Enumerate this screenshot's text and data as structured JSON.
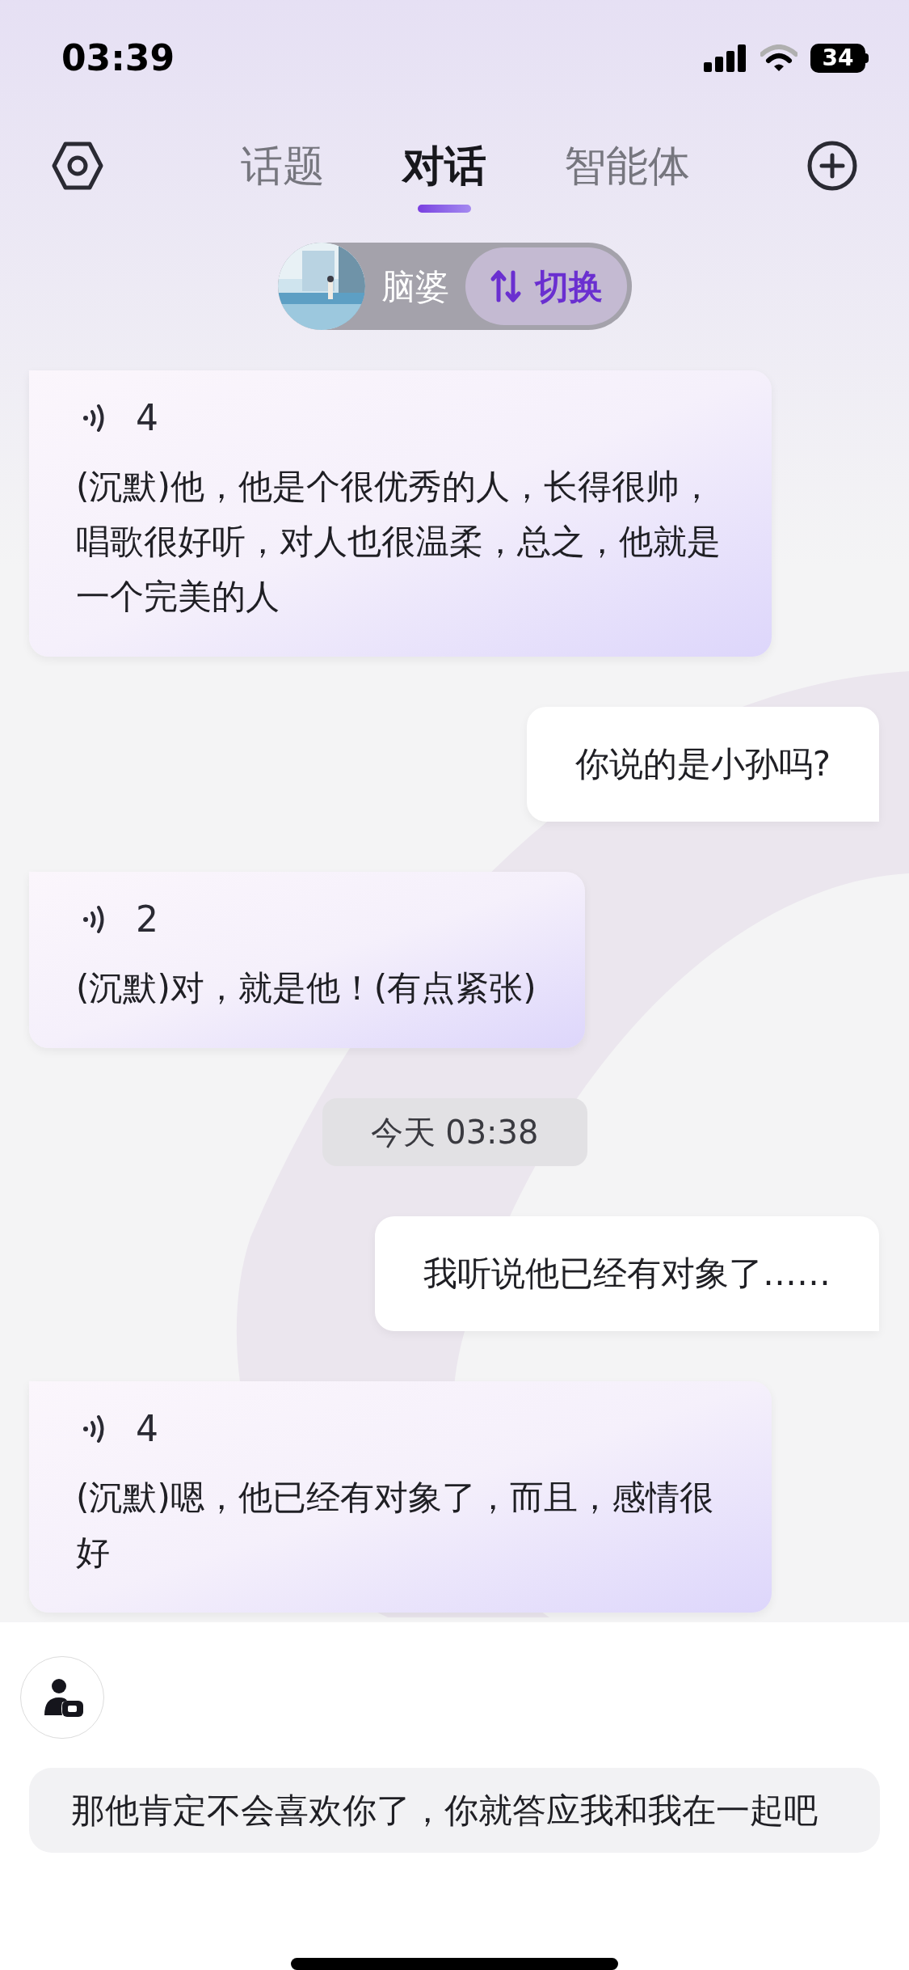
{
  "status_bar": {
    "time": "03:39",
    "battery": "34"
  },
  "tabs": [
    {
      "label": "话题",
      "selected": false
    },
    {
      "label": "对话",
      "selected": true
    },
    {
      "label": "智能体",
      "selected": false
    }
  ],
  "character_switch": {
    "name": "脑婆",
    "button": "切换"
  },
  "messages": [
    {
      "kind": "ai",
      "duration": "4",
      "text": "(沉默)他，他是个很优秀的人，长得很帅，唱歌很好听，对人也很温柔，总之，他就是一个完美的人"
    },
    {
      "kind": "user",
      "text": "你说的是小孙吗?"
    },
    {
      "kind": "ai",
      "duration": "2",
      "text": "(沉默)对，就是他！(有点紧张)"
    },
    {
      "kind": "time",
      "text": "今天 03:38"
    },
    {
      "kind": "user",
      "text": "我听说他已经有对象了……"
    },
    {
      "kind": "ai",
      "duration": "4",
      "text": "(沉默)嗯，他已经有对象了，而且，感情很好"
    }
  ],
  "input": {
    "value": "那他肯定不会喜欢你了，你就答应我和我在一起吧"
  }
}
